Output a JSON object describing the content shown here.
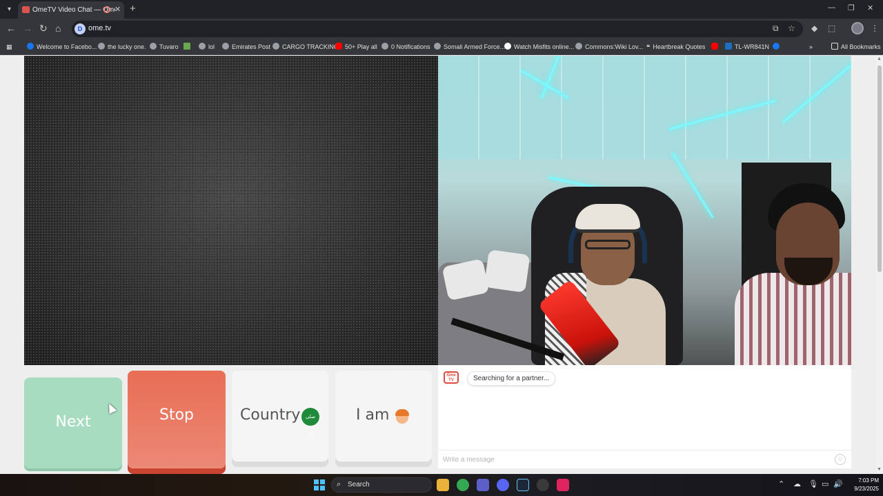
{
  "browser": {
    "tab_title": "OmeTV Video Chat — Ome",
    "url": "ome.tv",
    "site_badge": "D",
    "bookmarks": [
      {
        "label": "Welcome to Facebo...",
        "icon": "facebook-icon"
      },
      {
        "label": "the lucky one.",
        "icon": "globe-icon"
      },
      {
        "label": "Tuvaro",
        "icon": "globe-icon"
      },
      {
        "label": "",
        "icon": "microsoft-icon"
      },
      {
        "label": "lol",
        "icon": "globe-icon"
      },
      {
        "label": "Emirates Post",
        "icon": "globe-icon"
      },
      {
        "label": "CARGO TRACKING",
        "icon": "globe-icon"
      },
      {
        "label": "50+ Play all",
        "icon": "youtube-icon"
      },
      {
        "label": "0 Notifications",
        "icon": "globe-icon"
      },
      {
        "label": "Somali Armed Force...",
        "icon": "globe-icon"
      },
      {
        "label": "Watch Misfits online...",
        "icon": "google-icon"
      },
      {
        "label": "Commons:Wiki Lov...",
        "icon": "wikimedia-icon"
      },
      {
        "label": "Heartbreak Quotes",
        "icon": "quote-icon"
      },
      {
        "label": "",
        "icon": "youtube-icon"
      },
      {
        "label": "TL-WR841N",
        "icon": "tplink-icon"
      },
      {
        "label": "",
        "icon": "facebook-icon"
      }
    ],
    "all_bookmarks": "All Bookmarks"
  },
  "controls": {
    "next": "Next",
    "stop": "Stop",
    "country": "Country",
    "country_flag": "صلى الله",
    "i_am": "I am"
  },
  "chat": {
    "logo_text": "Ome TV",
    "status": "Searching for a partner...",
    "placeholder": "Write a message"
  },
  "taskbar": {
    "search": "Search",
    "time": "7:03 PM",
    "date": "9/23/2025"
  },
  "colors": {
    "next": "#a7dcc0",
    "stop": "#e86e55",
    "accent_logo": "#e04a3a"
  }
}
